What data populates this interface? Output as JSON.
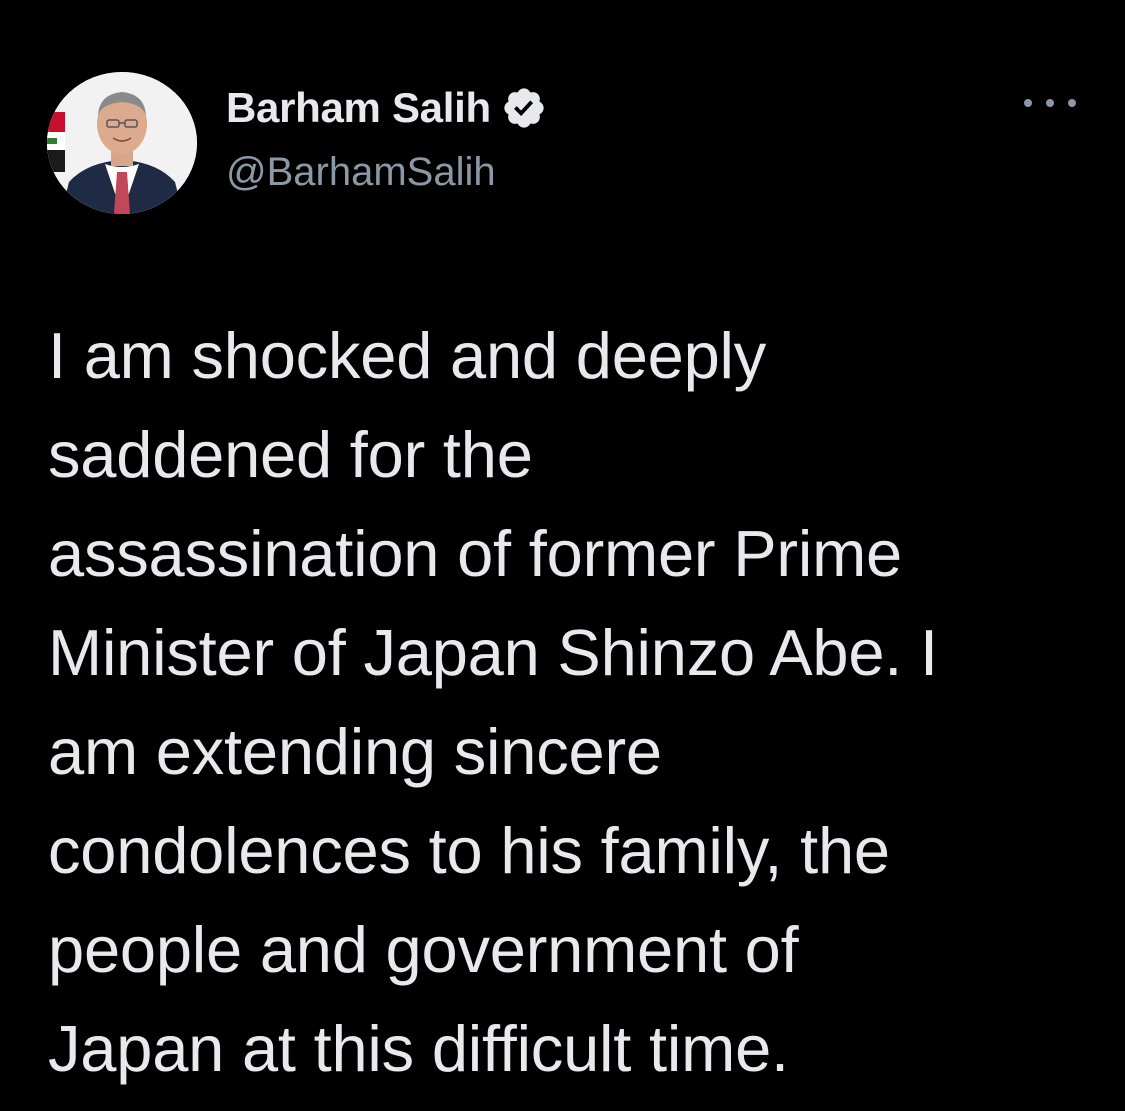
{
  "author": {
    "display_name": "Barham Salih",
    "handle": "@BarhamSalih",
    "verified": true,
    "avatar_icon": "profile-photo"
  },
  "tweet": {
    "text": "I am shocked and deeply\nsaddened for the\nassassination of former Prime\nMinister of Japan Shinzo Abe. I\nam extending sincere\ncondolences to his family, the\npeople and government of\nJapan at this difficult time."
  },
  "actions": {
    "more_icon": "more-horizontal-icon"
  },
  "colors": {
    "background": "#000000",
    "text_primary": "#e7e9ea",
    "text_secondary": "#8b98a5",
    "verified_badge": "#e7e9ea"
  }
}
